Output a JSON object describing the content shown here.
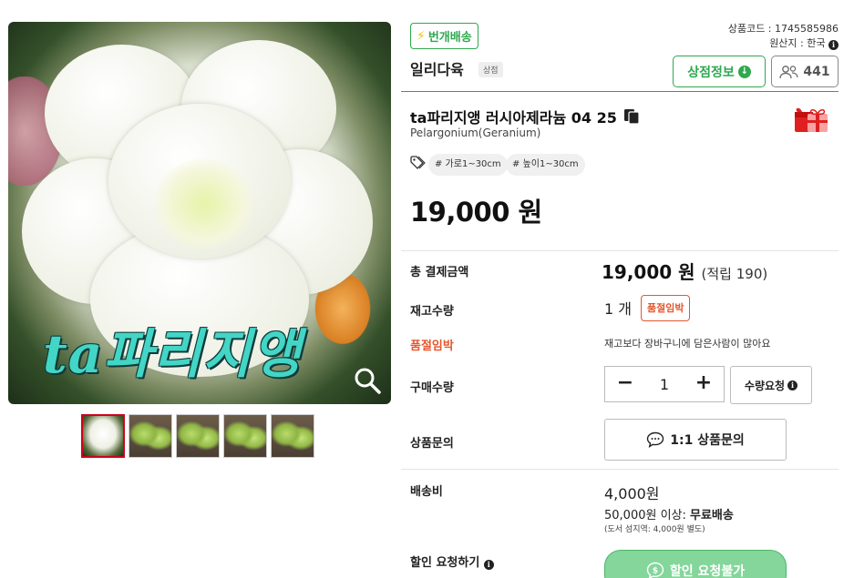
{
  "gallery": {
    "overlay_text": "ta파리지앵",
    "zoom_icon": "magnifier-icon",
    "thumbnail_count": 5
  },
  "product": {
    "fast_delivery_label": "번개배송",
    "code_label": "상품코드 : 1745585986",
    "origin_label": "원산지 : 한국",
    "shop_name": "일리다육",
    "shop_tag": "상점",
    "shop_info_button": "상점정보",
    "follower_count": "441",
    "title": "ta파리지앵 러시아제라늄 04 25",
    "subtitle": "Pelargonium(Geranium)",
    "tags": [
      "# 가로1~30cm",
      "# 높이1~30cm"
    ],
    "price": "19,000 원"
  },
  "purchase": {
    "total_label": "총 결제금액",
    "total_value": "19,000 원",
    "points": "(적립 190)",
    "stock_label": "재고수량",
    "stock_value": "1 개",
    "soldout_badge": "품절임박",
    "warning_label": "품절임박",
    "warning_text": "재고보다 장바구니에 담은사람이 많아요",
    "qty_label": "구매수량",
    "qty_minus": "−",
    "qty_value": "1",
    "qty_plus": "+",
    "qty_request_button": "수량요청",
    "inquiry_label": "상품문의",
    "inquiry_button": "1:1 상품문의",
    "shipping_label": "배송비",
    "shipping_fee": "4,000원",
    "free_shipping_prefix": "50,000원 이상: ",
    "free_shipping_bold": "무료배송",
    "island_note": "(도서 섬지역: 4,000원 별도)",
    "discount_label": "할인 요청하기",
    "discount_button": "할인 요청불가"
  },
  "colors": {
    "accent_green": "#2fa84f",
    "warning_orange": "#e4572e",
    "thumb_active_border": "#d0021b"
  }
}
